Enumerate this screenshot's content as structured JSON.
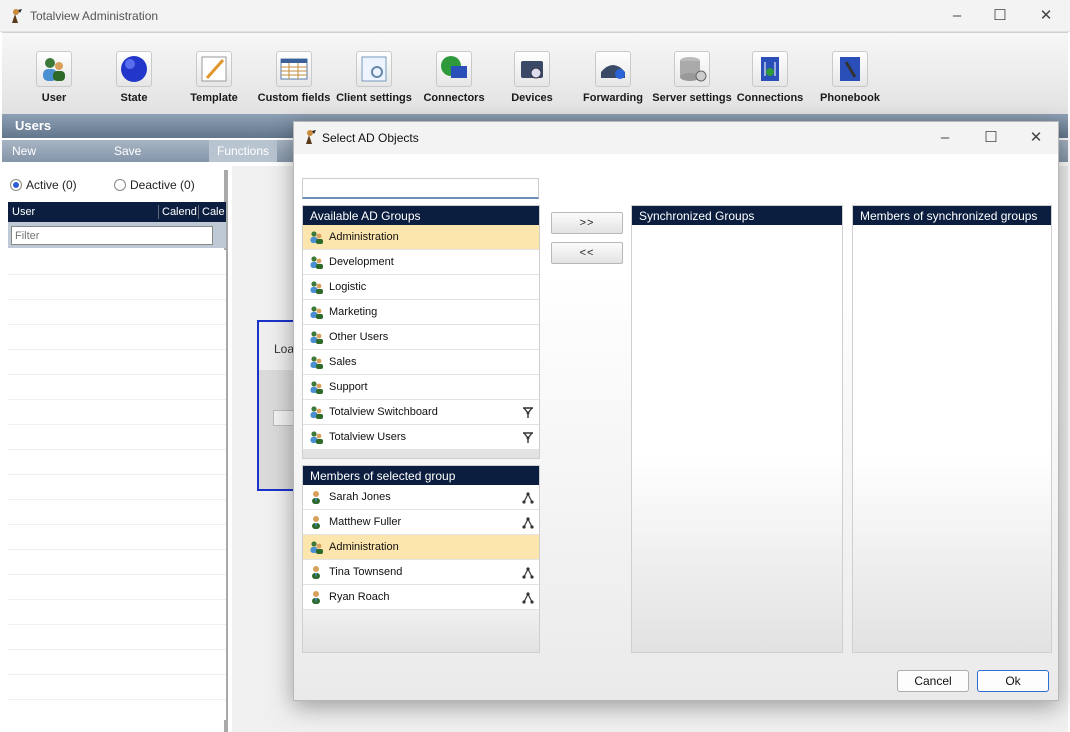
{
  "window": {
    "title": "Totalview  Administration"
  },
  "toolbar": {
    "items": [
      {
        "label": "User",
        "icon": "user-icon"
      },
      {
        "label": "State",
        "icon": "state-icon"
      },
      {
        "label": "Template",
        "icon": "template-icon"
      },
      {
        "label": "Custom fields",
        "icon": "custom-fields-icon"
      },
      {
        "label": "Client settings",
        "icon": "client-settings-icon"
      },
      {
        "label": "Connectors",
        "icon": "connectors-icon"
      },
      {
        "label": "Devices",
        "icon": "devices-icon"
      },
      {
        "label": "Forwarding",
        "icon": "forwarding-icon"
      },
      {
        "label": "Server settings",
        "icon": "server-settings-icon"
      },
      {
        "label": "Connections",
        "icon": "connections-icon"
      },
      {
        "label": "Phonebook",
        "icon": "phonebook-icon"
      }
    ]
  },
  "section": {
    "title": "Users"
  },
  "menu": {
    "new": "New",
    "save": "Save",
    "functions": "Functions"
  },
  "users_panel": {
    "active_label": "Active (0)",
    "deactive_label": "Deactive (0)",
    "columns": [
      "User",
      "Calend",
      "Cale"
    ],
    "filter_placeholder": "Filter"
  },
  "background": {
    "loading_text": "Loa"
  },
  "dialog": {
    "title": "Select AD Objects",
    "search_value": "",
    "available": {
      "header": "Available AD Groups",
      "items": [
        {
          "label": "Administration",
          "selected": true,
          "nested": false
        },
        {
          "label": "Development",
          "selected": false,
          "nested": false
        },
        {
          "label": "Logistic",
          "selected": false,
          "nested": false
        },
        {
          "label": "Marketing",
          "selected": false,
          "nested": false
        },
        {
          "label": "Other Users",
          "selected": false,
          "nested": false
        },
        {
          "label": "Sales",
          "selected": false,
          "nested": false
        },
        {
          "label": "Support",
          "selected": false,
          "nested": false
        },
        {
          "label": "Totalview Switchboard",
          "selected": false,
          "nested": true
        },
        {
          "label": "Totalview Users",
          "selected": false,
          "nested": true
        }
      ]
    },
    "members": {
      "header": "Members of selected group",
      "items": [
        {
          "label": "Sarah Jones",
          "selected": false,
          "type": "user"
        },
        {
          "label": "Matthew Fuller",
          "selected": false,
          "type": "user"
        },
        {
          "label": "Administration",
          "selected": true,
          "type": "group"
        },
        {
          "label": "Tina Townsend",
          "selected": false,
          "type": "user"
        },
        {
          "label": "Ryan Roach",
          "selected": false,
          "type": "user"
        }
      ]
    },
    "add_button": ">>",
    "remove_button": "<<",
    "synchronized": {
      "header": "Synchronized Groups"
    },
    "sync_members": {
      "header": "Members of synchronized groups"
    },
    "cancel_button": "Cancel",
    "ok_button": "Ok"
  },
  "colors": {
    "header_navy": "#0b1e3f",
    "selection": "#fde6ad",
    "section_bar": "#62768c",
    "accent_border": "#2b6dd1"
  }
}
